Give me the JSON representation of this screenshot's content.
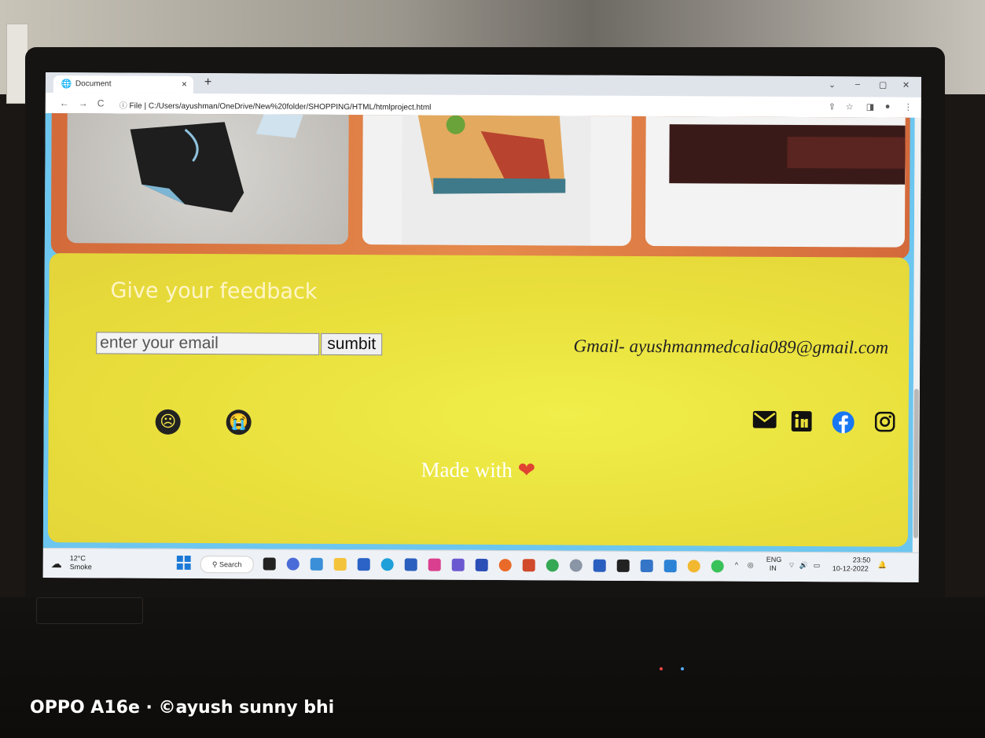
{
  "browser": {
    "tab_title": "Document",
    "tab_close": "×",
    "new_tab": "+",
    "url_prefix": "File",
    "url": "C:/Users/ayushman/OneDrive/New%20folder/SHOPPING/HTML/htmlproject.html"
  },
  "feedback": {
    "title": "Give your feedback",
    "email_placeholder": "enter your email",
    "submit_label": "sumbit",
    "contact_text": "Gmail- ayushmanmedcalia089@gmail.com",
    "made_with_text": "Made with",
    "heart": "❤"
  },
  "taskbar": {
    "temperature": "12°C",
    "weather_desc": "Smoke",
    "search_label": "Search",
    "lang_top": "ENG",
    "lang_bottom": "IN",
    "time": "23:50",
    "date": "10-12-2022"
  },
  "photo_watermark": "OPPO A16e · ©ayush sunny bhi",
  "colors": {
    "feedback_bg": "#e9df3b",
    "orange_frame": "#d36a3a",
    "sky_border": "#6cc6ef",
    "heart": "#e04332"
  }
}
